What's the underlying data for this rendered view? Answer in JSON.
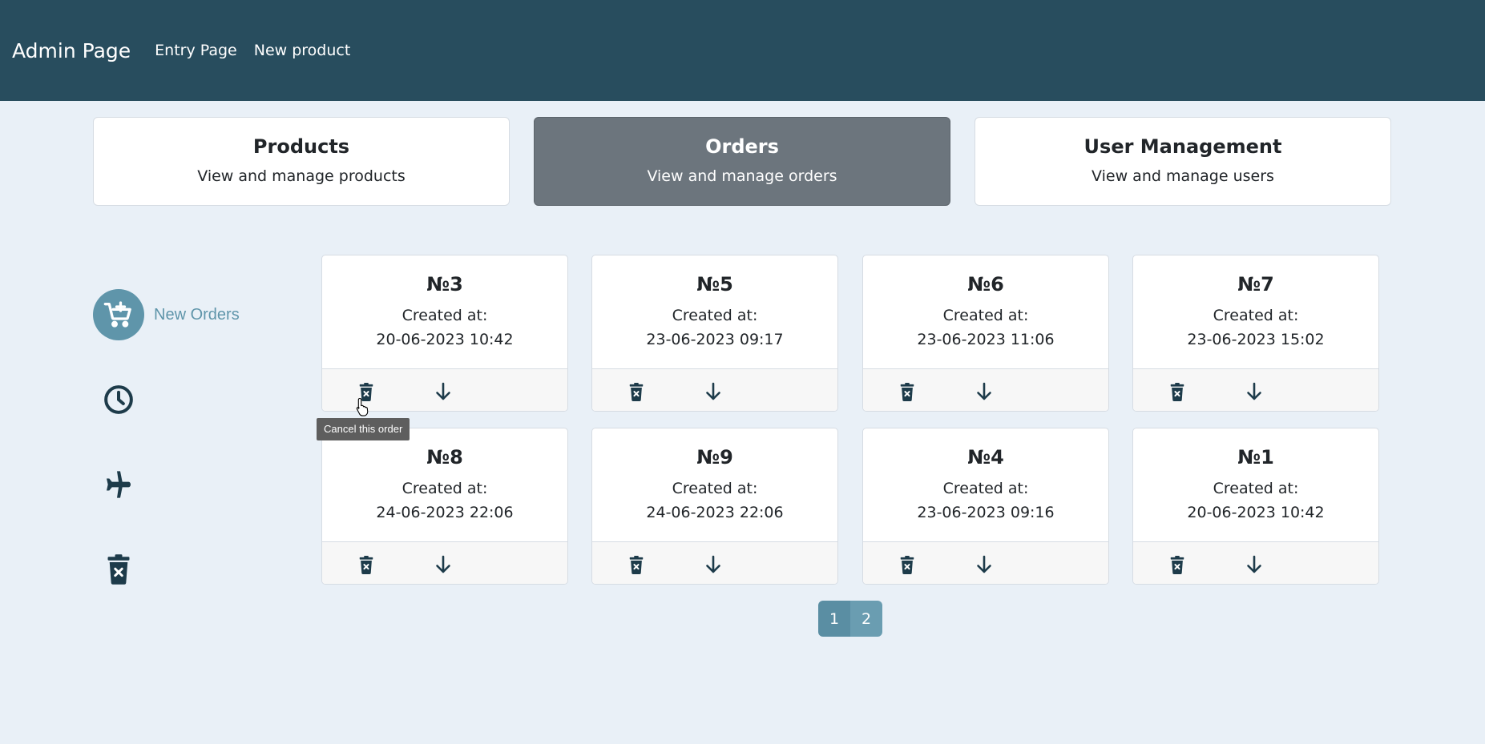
{
  "navbar": {
    "brand": "Admin Page",
    "links": [
      "Entry Page",
      "New product"
    ]
  },
  "sections": [
    {
      "title": "Products",
      "desc": "View and manage products",
      "active": false
    },
    {
      "title": "Orders",
      "desc": "View and manage orders",
      "active": true
    },
    {
      "title": "User Management",
      "desc": "View and manage users",
      "active": false
    }
  ],
  "rail": {
    "new_orders_label": "New Orders",
    "icons": [
      "cart-plus-icon",
      "clock-icon",
      "airplane-icon",
      "trash-x-icon"
    ]
  },
  "orders": [
    {
      "no": "№3",
      "created_label": "Created at:",
      "date": "20-06-2023 10:42"
    },
    {
      "no": "№5",
      "created_label": "Created at:",
      "date": "23-06-2023 09:17"
    },
    {
      "no": "№6",
      "created_label": "Created at:",
      "date": "23-06-2023 11:06"
    },
    {
      "no": "№7",
      "created_label": "Created at:",
      "date": "23-06-2023 15:02"
    },
    {
      "no": "№8",
      "created_label": "Created at:",
      "date": "24-06-2023 22:06"
    },
    {
      "no": "№9",
      "created_label": "Created at:",
      "date": "24-06-2023 22:06"
    },
    {
      "no": "№4",
      "created_label": "Created at:",
      "date": "23-06-2023 09:16"
    },
    {
      "no": "№1",
      "created_label": "Created at:",
      "date": "20-06-2023 10:42"
    }
  ],
  "tooltip": "Cancel this order",
  "pagination": [
    "1",
    "2"
  ],
  "colors": {
    "navbar": "#284d5e",
    "accent": "#5f95aa",
    "background": "#e9f0f7",
    "active_section": "#6c757d",
    "icon": "#1d3b4a"
  }
}
